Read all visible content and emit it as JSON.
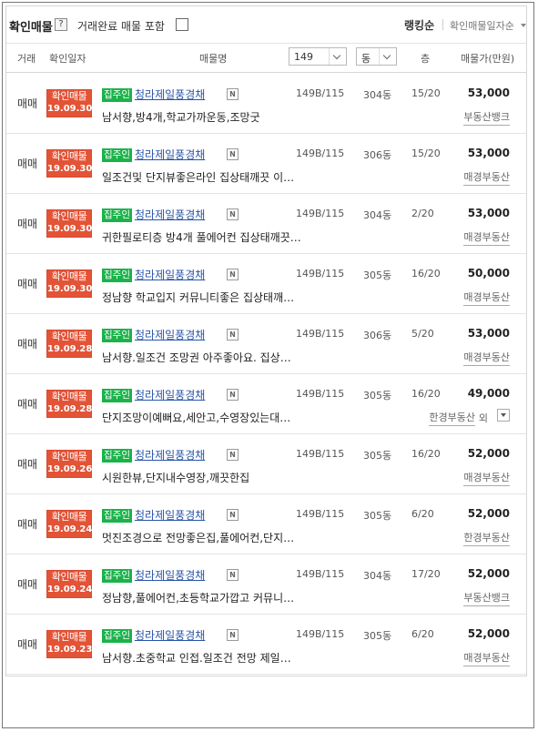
{
  "topbar": {
    "title": "확인매물",
    "help": "?",
    "include_label": "거래완료 매물 포함",
    "rank_label": "랭킹순",
    "sort_label": "확인매물일자순"
  },
  "header": {
    "deal": "거래",
    "date": "확인일자",
    "name": "매물명",
    "area_select": "149",
    "dong_select": "동",
    "floor": "층",
    "price": "매물가(만원)"
  },
  "rows": [
    {
      "deal": "매매",
      "stamp": "확인매물",
      "date": "19.09.30.",
      "badge": "집주인",
      "name": "청라제일풍경채",
      "nicon": "N",
      "desc": "남서향,방4개,학교가까운동,조망굿",
      "area": "149B/115",
      "dong": "304동",
      "floor": "15/20",
      "price": "53,000",
      "agent": "부동산뱅크",
      "extra": ""
    },
    {
      "deal": "매매",
      "stamp": "확인매물",
      "date": "19.09.30.",
      "badge": "집주인",
      "name": "청라제일풍경채",
      "nicon": "N",
      "desc": "일조건및 단지뷰좋은라인 집상태깨끗 이…",
      "area": "149B/115",
      "dong": "306동",
      "floor": "15/20",
      "price": "53,000",
      "agent": "매경부동산",
      "extra": ""
    },
    {
      "deal": "매매",
      "stamp": "확인매물",
      "date": "19.09.30.",
      "badge": "집주인",
      "name": "청라제일풍경채",
      "nicon": "N",
      "desc": "귀한필로티층 방4개 풀에어컨 집상태깨끗…",
      "area": "149B/115",
      "dong": "304동",
      "floor": "2/20",
      "price": "53,000",
      "agent": "매경부동산",
      "extra": ""
    },
    {
      "deal": "매매",
      "stamp": "확인매물",
      "date": "19.09.30.",
      "badge": "집주인",
      "name": "청라제일풍경채",
      "nicon": "N",
      "desc": "정남향 학교입지 커뮤니티좋은 집상태깨…",
      "area": "149B/115",
      "dong": "305동",
      "floor": "16/20",
      "price": "50,000",
      "agent": "매경부동산",
      "extra": ""
    },
    {
      "deal": "매매",
      "stamp": "확인매물",
      "date": "19.09.28.",
      "badge": "집주인",
      "name": "청라제일풍경채",
      "nicon": "N",
      "desc": "남서향.일조건 조망권 아주좋아요. 집상…",
      "area": "149B/115",
      "dong": "306동",
      "floor": "5/20",
      "price": "53,000",
      "agent": "매경부동산",
      "extra": ""
    },
    {
      "deal": "매매",
      "stamp": "확인매물",
      "date": "19.09.28.",
      "badge": "집주인",
      "name": "청라제일풍경채",
      "nicon": "N",
      "desc": "단지조망이예뻐요,세안고,수영장있는대…",
      "area": "149B/115",
      "dong": "305동",
      "floor": "16/20",
      "price": "49,000",
      "agent": "한경부동산",
      "extra": "외"
    },
    {
      "deal": "매매",
      "stamp": "확인매물",
      "date": "19.09.26.",
      "badge": "집주인",
      "name": "청라제일풍경채",
      "nicon": "N",
      "desc": "시원한뷰,단지내수영장,깨끗한집",
      "area": "149B/115",
      "dong": "305동",
      "floor": "16/20",
      "price": "52,000",
      "agent": "매경부동산",
      "extra": ""
    },
    {
      "deal": "매매",
      "stamp": "확인매물",
      "date": "19.09.24.",
      "badge": "집주인",
      "name": "청라제일풍경채",
      "nicon": "N",
      "desc": "멋진조경으로 전망좋은집,풀에어컨,단지…",
      "area": "149B/115",
      "dong": "305동",
      "floor": "6/20",
      "price": "52,000",
      "agent": "한경부동산",
      "extra": ""
    },
    {
      "deal": "매매",
      "stamp": "확인매물",
      "date": "19.09.24.",
      "badge": "집주인",
      "name": "청라제일풍경채",
      "nicon": "N",
      "desc": "정남향,풀에어컨,초등학교가깝고 커뮤니…",
      "area": "149B/115",
      "dong": "304동",
      "floor": "17/20",
      "price": "52,000",
      "agent": "부동산뱅크",
      "extra": ""
    },
    {
      "deal": "매매",
      "stamp": "확인매물",
      "date": "19.09.23.",
      "badge": "집주인",
      "name": "청라제일풍경채",
      "nicon": "N",
      "desc": "남서향.초중학교 인접.일조건 전망 제일…",
      "area": "149B/115",
      "dong": "305동",
      "floor": "6/20",
      "price": "52,000",
      "agent": "매경부동산",
      "extra": ""
    }
  ]
}
